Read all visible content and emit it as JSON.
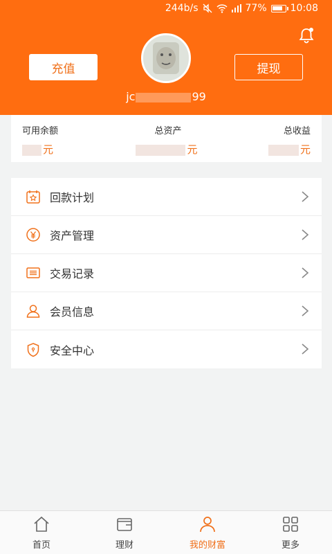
{
  "status_bar": {
    "speed": "244b/s",
    "battery_pct": "77%",
    "time": "10:08"
  },
  "header": {
    "recharge_label": "充值",
    "withdraw_label": "提现",
    "username_prefix": "jc",
    "username_suffix": "99",
    "accent_color": "#ff6d10"
  },
  "assets": {
    "available": {
      "label": "可用余额",
      "unit": "元"
    },
    "total": {
      "label": "总资产",
      "unit": "元"
    },
    "earnings": {
      "label": "总收益",
      "unit": "元"
    }
  },
  "menu": {
    "items": [
      {
        "label": "回款计划",
        "icon": "calendar-star-icon"
      },
      {
        "label": "资产管理",
        "icon": "yuan-coin-icon"
      },
      {
        "label": "交易记录",
        "icon": "receipt-icon"
      },
      {
        "label": "会员信息",
        "icon": "user-icon"
      },
      {
        "label": "安全中心",
        "icon": "shield-icon"
      }
    ]
  },
  "tabbar": {
    "tabs": [
      {
        "label": "首页",
        "icon": "home-icon",
        "active": false
      },
      {
        "label": "理财",
        "icon": "wallet-icon",
        "active": false
      },
      {
        "label": "我的财富",
        "icon": "person-icon",
        "active": true
      },
      {
        "label": "更多",
        "icon": "grid-icon",
        "active": false
      }
    ]
  }
}
